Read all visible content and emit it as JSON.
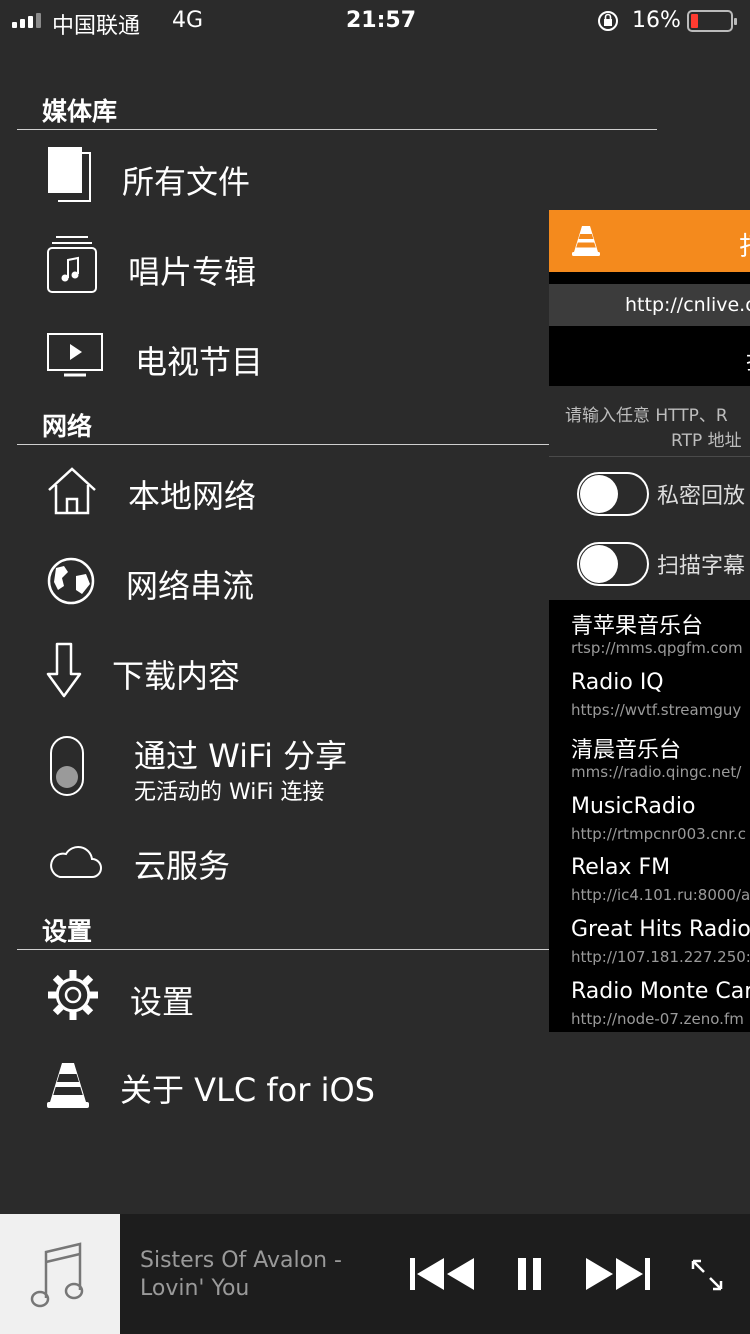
{
  "status_bar": {
    "carrier": "中国联通",
    "network": "4G",
    "time": "21:57",
    "battery": "16%"
  },
  "colors": {
    "accent": "#f48a1d",
    "background": "#2b2b2b",
    "battery_low": "#ff3b30"
  },
  "sidebar": {
    "sections": [
      {
        "title": "媒体库",
        "items": [
          {
            "label": "所有文件",
            "icon": "files-icon"
          },
          {
            "label": "唱片专辑",
            "icon": "music-album-icon"
          },
          {
            "label": "电视节目",
            "icon": "tv-icon"
          }
        ]
      },
      {
        "title": "网络",
        "items": [
          {
            "label": "本地网络",
            "icon": "home-icon"
          },
          {
            "label": "网络串流",
            "icon": "globe-icon"
          },
          {
            "label": "下载内容",
            "icon": "download-icon"
          },
          {
            "label": "通过 WiFi 分享",
            "sublabel": "无活动的 WiFi 连接",
            "icon": "wifi-toggle-icon"
          },
          {
            "label": "云服务",
            "icon": "cloud-icon"
          }
        ]
      },
      {
        "title": "设置",
        "items": [
          {
            "label": "设置",
            "icon": "gear-icon"
          },
          {
            "label": "关于 VLC for iOS",
            "icon": "vlc-cone-icon"
          }
        ]
      }
    ]
  },
  "stream_panel": {
    "header_title": "打",
    "url_value": "http://cnlive.c",
    "open_label": "打",
    "hint": [
      "请输入任意 HTTP、R",
      "RTP 地址"
    ],
    "toggles": [
      {
        "label": "私密回放",
        "on": false
      },
      {
        "label": "扫描字幕",
        "on": false
      }
    ],
    "history": [
      {
        "title": "青苹果音乐台",
        "url": "rtsp://mms.qpgfm.com"
      },
      {
        "title": "Radio IQ",
        "url": "https://wvtf.streamguy"
      },
      {
        "title": "清晨音乐台",
        "url": "mms://radio.qingc.net/"
      },
      {
        "title": "MusicRadio",
        "url": "http://rtmpcnr003.cnr.c"
      },
      {
        "title": "Relax FM",
        "url": "http://ic4.101.ru:8000/a"
      },
      {
        "title": "Great Hits Radio",
        "url": "http://107.181.227.250:"
      },
      {
        "title": "Radio Monte Car",
        "url": "http://node-07.zeno.fm"
      }
    ]
  },
  "player": {
    "line1": "Sisters Of Avalon -",
    "line2": "Lovin' You"
  }
}
